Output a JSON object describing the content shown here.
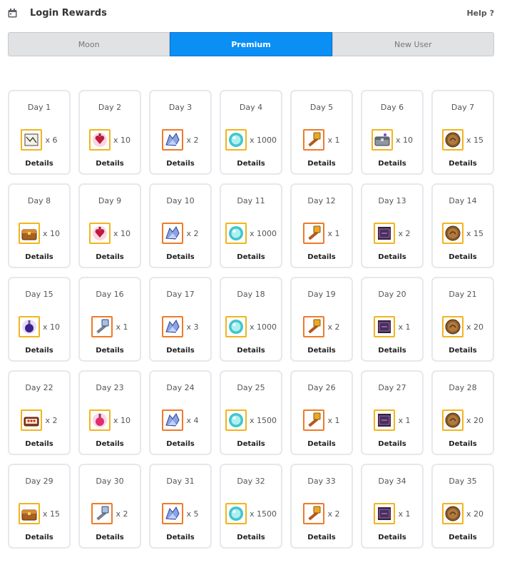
{
  "header": {
    "title": "Login Rewards",
    "help": "Help ?"
  },
  "tabs": [
    {
      "label": "Moon",
      "active": false
    },
    {
      "label": "Premium",
      "active": true
    },
    {
      "label": "New User",
      "active": false
    }
  ],
  "colors": {
    "accent": "#0a8ff5",
    "item_border_gold": "#f3b41c",
    "item_border_orange": "#f07a28"
  },
  "days": [
    {
      "day": "Day 1",
      "item": "scroll-icon",
      "qty": "x 6"
    },
    {
      "day": "Day 2",
      "item": "heart-potion-icon",
      "qty": "x 10"
    },
    {
      "day": "Day 3",
      "item": "crystal-bird-icon",
      "qty": "x 2"
    },
    {
      "day": "Day 4",
      "item": "cyan-orb-icon",
      "qty": "x 1000"
    },
    {
      "day": "Day 5",
      "item": "gold-hammer-icon",
      "qty": "x 1"
    },
    {
      "day": "Day 6",
      "item": "silver-chest-icon",
      "qty": "x 10"
    },
    {
      "day": "Day 7",
      "item": "bronze-coin-icon",
      "qty": "x 15"
    },
    {
      "day": "Day 8",
      "item": "treasure-chest-icon",
      "qty": "x 10"
    },
    {
      "day": "Day 9",
      "item": "heart-potion-icon",
      "qty": "x 10"
    },
    {
      "day": "Day 10",
      "item": "crystal-bird-icon",
      "qty": "x 2"
    },
    {
      "day": "Day 11",
      "item": "cyan-orb-icon",
      "qty": "x 1000"
    },
    {
      "day": "Day 12",
      "item": "gold-hammer-icon",
      "qty": "x 1"
    },
    {
      "day": "Day 13",
      "item": "dark-scroll-icon",
      "qty": "x 2"
    },
    {
      "day": "Day 14",
      "item": "bronze-coin-icon",
      "qty": "x 15"
    },
    {
      "day": "Day 15",
      "item": "purple-potion-icon",
      "qty": "x 10"
    },
    {
      "day": "Day 16",
      "item": "silver-hammer-icon",
      "qty": "x 1"
    },
    {
      "day": "Day 17",
      "item": "crystal-bird-icon",
      "qty": "x 3"
    },
    {
      "day": "Day 18",
      "item": "cyan-orb-icon",
      "qty": "x 1000"
    },
    {
      "day": "Day 19",
      "item": "gold-hammer-icon",
      "qty": "x 2"
    },
    {
      "day": "Day 20",
      "item": "dark-scroll-icon",
      "qty": "x 1"
    },
    {
      "day": "Day 21",
      "item": "bronze-coin-icon",
      "qty": "x 20"
    },
    {
      "day": "Day 22",
      "item": "ruby-chest-icon",
      "qty": "x 2"
    },
    {
      "day": "Day 23",
      "item": "pink-potion-icon",
      "qty": "x 10"
    },
    {
      "day": "Day 24",
      "item": "crystal-bird-icon",
      "qty": "x 4"
    },
    {
      "day": "Day 25",
      "item": "cyan-orb-icon",
      "qty": "x 1500"
    },
    {
      "day": "Day 26",
      "item": "gold-hammer-icon",
      "qty": "x 1"
    },
    {
      "day": "Day 27",
      "item": "dark-scroll-icon",
      "qty": "x 1"
    },
    {
      "day": "Day 28",
      "item": "bronze-coin-icon",
      "qty": "x 20"
    },
    {
      "day": "Day 29",
      "item": "treasure-chest-icon",
      "qty": "x 15"
    },
    {
      "day": "Day 30",
      "item": "silver-hammer-icon",
      "qty": "x 2"
    },
    {
      "day": "Day 31",
      "item": "crystal-bird-icon",
      "qty": "x 5"
    },
    {
      "day": "Day 32",
      "item": "cyan-orb-icon",
      "qty": "x 1500"
    },
    {
      "day": "Day 33",
      "item": "gold-hammer-icon",
      "qty": "x 2"
    },
    {
      "day": "Day 34",
      "item": "dark-scroll-icon",
      "qty": "x 1"
    },
    {
      "day": "Day 35",
      "item": "bronze-coin-icon",
      "qty": "x 20"
    }
  ],
  "details_label": "Details"
}
